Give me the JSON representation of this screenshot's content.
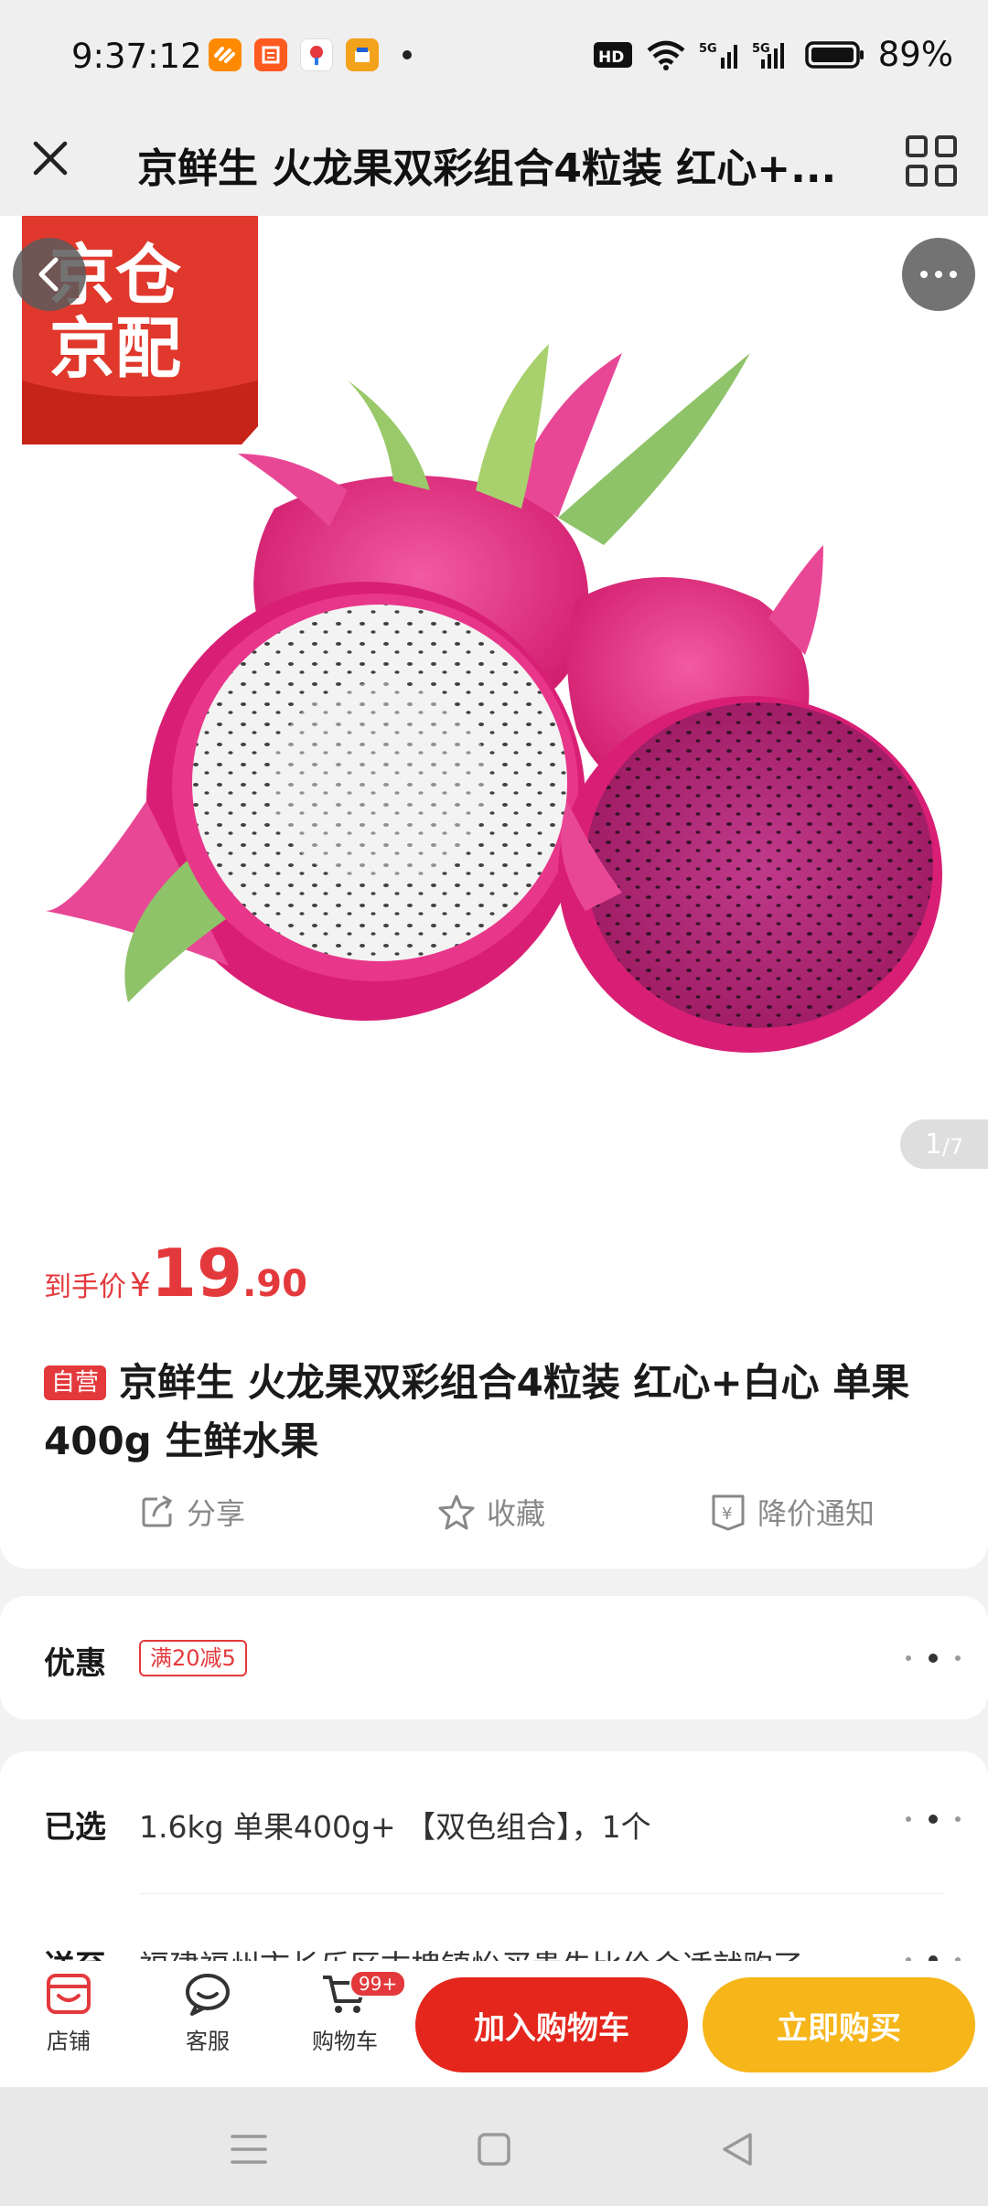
{
  "status_bar": {
    "time": "9:37:12",
    "network": "5G",
    "battery": "89%",
    "apps": [
      "taobao-icon",
      "manman-icon",
      "map-icon",
      "shop-icon"
    ]
  },
  "title_bar": {
    "title": "京鲜生 火龙果双彩组合4粒装 红心+..."
  },
  "hero": {
    "badge_line1": "京仓",
    "badge_line2": "京配",
    "page_current": "1",
    "page_total": "/7"
  },
  "price": {
    "label": "到手价",
    "currency": "¥",
    "integer": "19",
    "decimal": ".90"
  },
  "product": {
    "tag": "自营",
    "title": "京鲜生 火龙果双彩组合4粒装 红心+白心 单果400g 生鲜水果"
  },
  "actions": {
    "share": "分享",
    "favorite": "收藏",
    "price_alert": "降价通知"
  },
  "promo": {
    "label": "优惠",
    "tag": "满20减5"
  },
  "selection": {
    "label": "已选",
    "value": "1.6kg 单果400g+ 【双色组合】，1个"
  },
  "shipping": {
    "label": "送至",
    "value": "福建福州市长乐区古槐镇怡买贵先比价合适就购了"
  },
  "bottom_bar": {
    "store": "店铺",
    "service": "客服",
    "cart": "购物车",
    "cart_badge": "99+",
    "add_to_cart": "加入购物车",
    "buy_now": "立即购买"
  },
  "colors": {
    "brand_red": "#e4393c",
    "cart_button": "#e4261c",
    "buy_button": "#f6b518"
  }
}
